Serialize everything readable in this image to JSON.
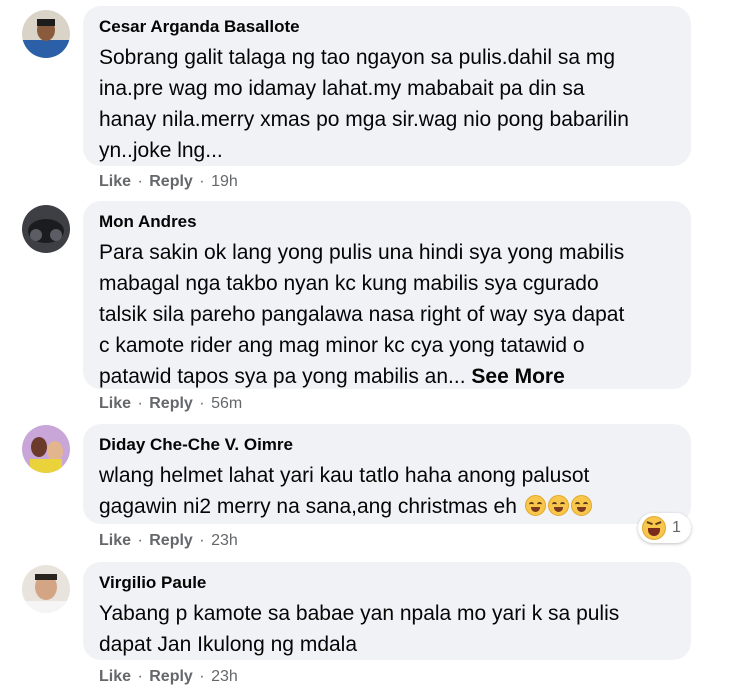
{
  "comments": [
    {
      "author": "Cesar Arganda Basallote",
      "lines": [
        "Sobrang galit talaga ng tao ngayon sa pulis.dahil sa mg",
        "ina.pre wag mo idamay lahat.my mababait pa din sa",
        "hanay nila.merry xmas po mga sir.wag nio pong babarilin",
        "yn..joke lng..."
      ],
      "like": "Like",
      "reply": "Reply",
      "time": "19h"
    },
    {
      "author": "Mon Andres",
      "lines": [
        "Para sakin ok lang yong pulis una hindi sya yong mabilis",
        "mabagal nga takbo nyan kc kung mabilis sya cgurado",
        "talsik sila pareho pangalawa nasa right of way sya dapat",
        "c kamote rider ang mag minor kc cya yong tatawid o",
        "patawid tapos sya pa yong mabilis an..."
      ],
      "see_more": "See More",
      "like": "Like",
      "reply": "Reply",
      "time": "56m"
    },
    {
      "author": "Diday Che-Che V. Oimre",
      "lines": [
        "wlang helmet lahat yari kau tatlo haha anong palusot",
        "gagawin ni2 merry na sana,ang christmas eh"
      ],
      "like": "Like",
      "reply": "Reply",
      "time": "23h",
      "reaction_count": "1"
    },
    {
      "author": "Virgilio Paule",
      "lines": [
        "Yabang p kamote sa babae yan npala mo yari k sa pulis",
        "dapat Jan Ikulong ng mdala"
      ],
      "like": "Like",
      "reply": "Reply",
      "time": "23h"
    }
  ],
  "actions_separator": "·",
  "icons": {
    "reaction": "haha-reaction-icon",
    "emoji": "grinning-face-emoji-icon"
  },
  "colors": {
    "bubble": "#f0f2f5",
    "meta_text": "#65676b"
  }
}
